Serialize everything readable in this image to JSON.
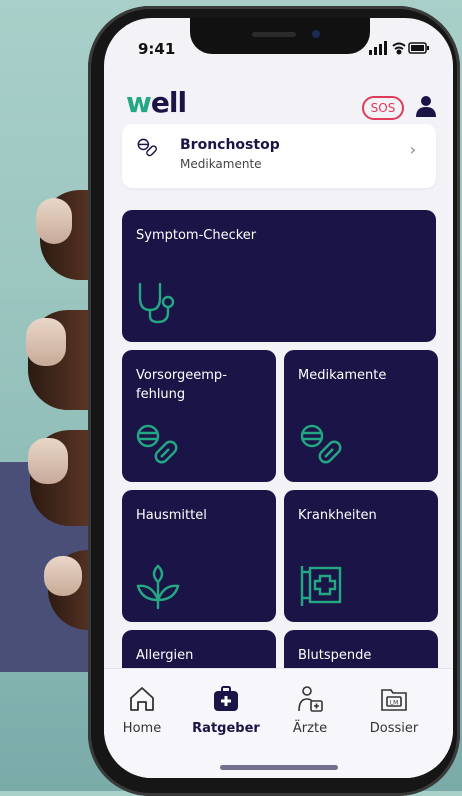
{
  "status_bar": {
    "time": "9:41"
  },
  "header": {
    "logo": "well",
    "sos_label": "SOS"
  },
  "recent": {
    "title": "Bronchostop",
    "subtitle": "Medikamente"
  },
  "tiles": [
    {
      "label": "Symptom-Checker",
      "icon": "stethoscope-icon"
    },
    {
      "label": "Vorsorgeemp-\nfehlung",
      "icon": "pills-icon"
    },
    {
      "label": "Medikamente",
      "icon": "pills-icon"
    },
    {
      "label": "Hausmittel",
      "icon": "plant-icon"
    },
    {
      "label": "Krankheiten",
      "icon": "pharmacy-sign-icon"
    },
    {
      "label": "Allergien",
      "icon": ""
    },
    {
      "label": "Blutspende",
      "icon": ""
    }
  ],
  "tabbar": [
    {
      "label": "Home",
      "icon": "home-icon",
      "active": false
    },
    {
      "label": "Ratgeber",
      "icon": "medical-bag-icon",
      "active": true
    },
    {
      "label": "Ärzte",
      "icon": "doctor-icon",
      "active": false
    },
    {
      "label": "Dossier",
      "icon": "folder-icon",
      "active": false
    }
  ],
  "colors": {
    "tile_bg": "#1b1447",
    "accent_green": "#24a884",
    "sos_red": "#e03a5a",
    "page_bg": "#f3f3f7"
  }
}
